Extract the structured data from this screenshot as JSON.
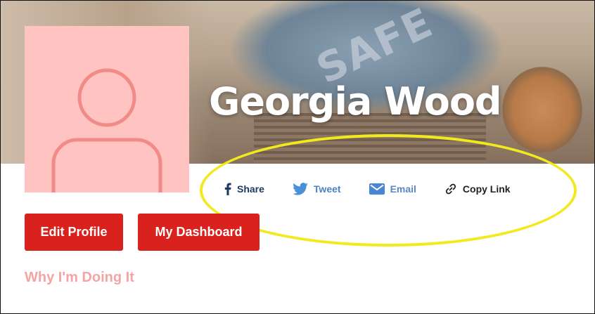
{
  "profile": {
    "name": "Georgia Wood"
  },
  "share": {
    "facebook_label": "Share",
    "twitter_label": "Tweet",
    "email_label": "Email",
    "copy_link_label": "Copy Link"
  },
  "actions": {
    "edit_profile_label": "Edit Profile",
    "dashboard_label": "My Dashboard"
  },
  "sections": {
    "why_label": "Why I'm Doing It"
  },
  "colors": {
    "primary_red": "#d9211e",
    "avatar_bg": "#ffc4c2",
    "avatar_icon": "#f28b87",
    "facebook": "#1c3c66",
    "twitter": "#4a83c4",
    "email": "#5a86c4",
    "highlight": "#f2ea1c",
    "why_text": "#f2a6a3"
  },
  "icons": {
    "facebook": "facebook-icon",
    "twitter": "twitter-icon",
    "email": "email-icon",
    "link": "link-icon",
    "avatar": "user-avatar-icon"
  }
}
